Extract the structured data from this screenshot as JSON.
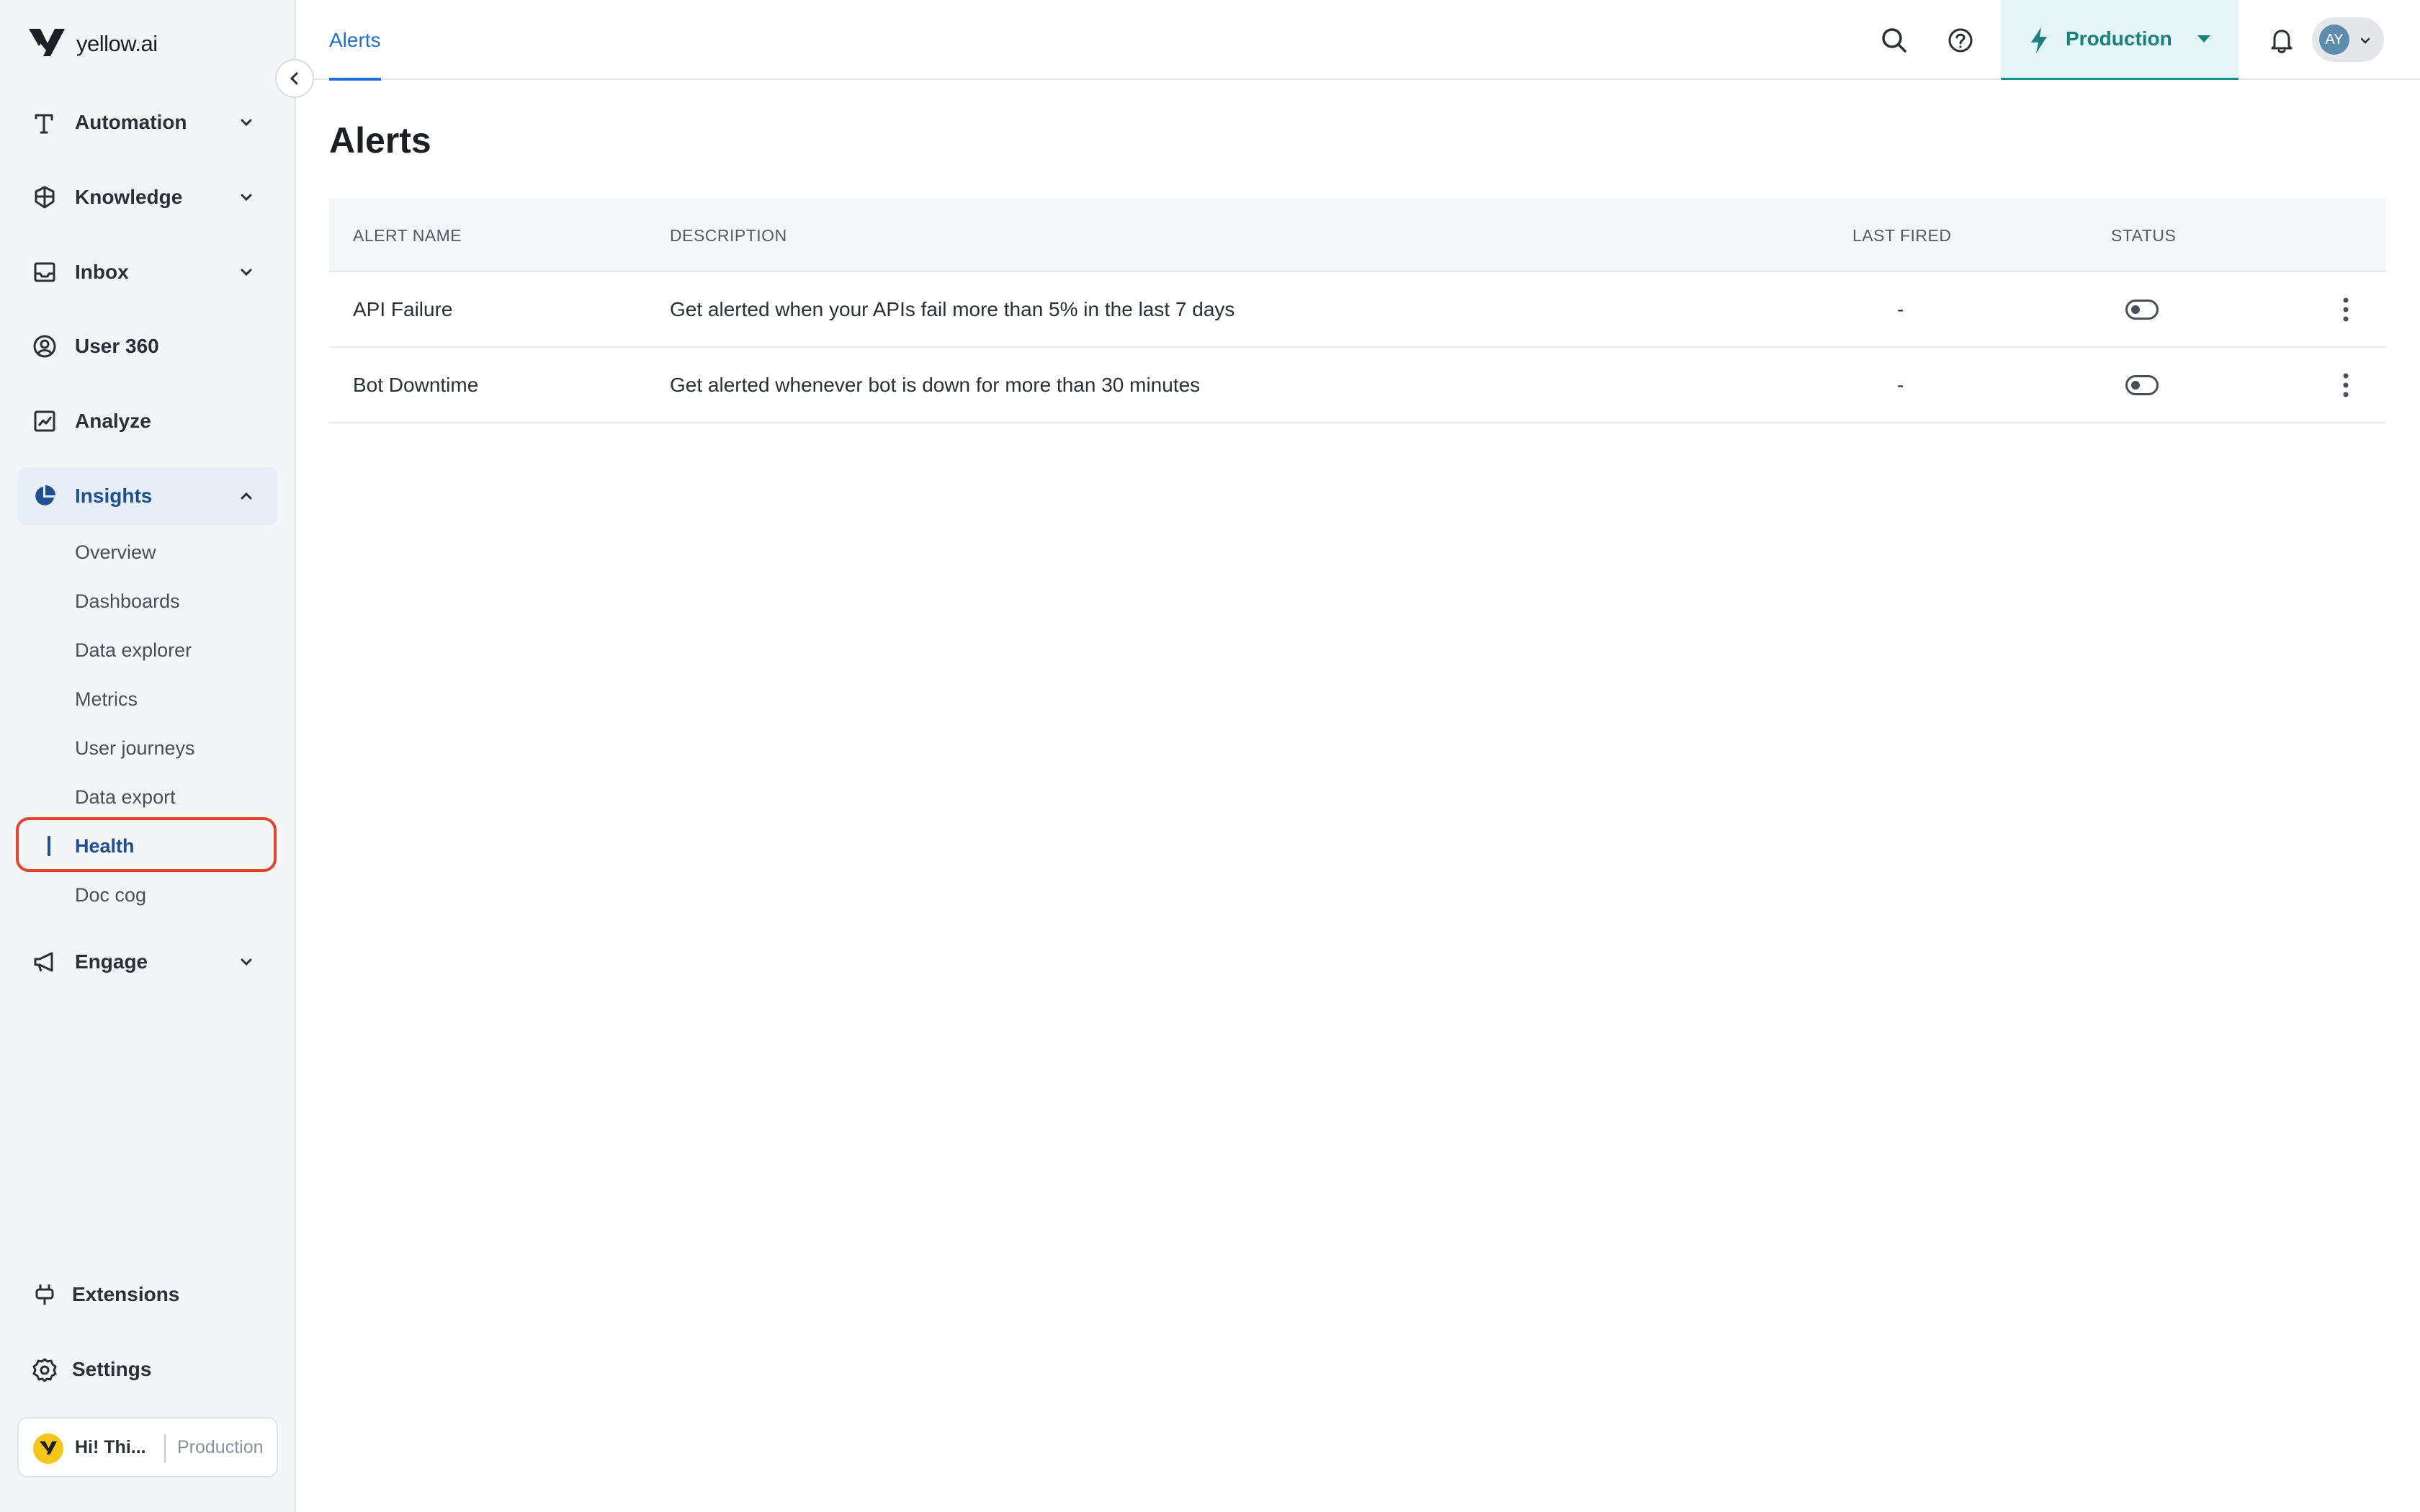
{
  "brand": {
    "name": "yellow.ai"
  },
  "sidebar": {
    "nav": [
      {
        "label": "Automation"
      },
      {
        "label": "Knowledge"
      },
      {
        "label": "Inbox"
      },
      {
        "label": "User 360"
      },
      {
        "label": "Analyze"
      },
      {
        "label": "Insights",
        "expanded": true
      }
    ],
    "insights_sub": [
      {
        "label": "Overview"
      },
      {
        "label": "Dashboards"
      },
      {
        "label": "Data explorer"
      },
      {
        "label": "Metrics"
      },
      {
        "label": "User journeys"
      },
      {
        "label": "Data export"
      },
      {
        "label": "Health",
        "active": true
      },
      {
        "label": "Doc cog"
      }
    ],
    "engage": {
      "label": "Engage"
    },
    "bottom": [
      {
        "label": "Extensions"
      },
      {
        "label": "Settings"
      }
    ],
    "bot": {
      "name": "Hi! Thi...",
      "env": "Production"
    }
  },
  "topbar": {
    "tab": "Alerts",
    "environment": "Production",
    "avatar_initials": "AY",
    "icons": [
      "search-icon",
      "help-icon",
      "lightning-icon",
      "bell-icon"
    ]
  },
  "main": {
    "title": "Alerts",
    "columns": [
      "ALERT NAME",
      "DESCRIPTION",
      "LAST FIRED",
      "STATUS"
    ],
    "rows": [
      {
        "name": "API Failure",
        "description": "Get alerted when your APIs fail more than 5% in the last 7 days",
        "last_fired": "-",
        "status": "off"
      },
      {
        "name": "Bot Downtime",
        "description": "Get alerted whenever bot is down for more than 30 minutes",
        "last_fired": "-",
        "status": "off"
      }
    ]
  },
  "colors": {
    "accent": "#1f6fd6",
    "active_nav": "#1d4f91",
    "env_bg": "#e5f4f4",
    "env_fg": "#1a8080",
    "highlight": "#e2442f"
  }
}
